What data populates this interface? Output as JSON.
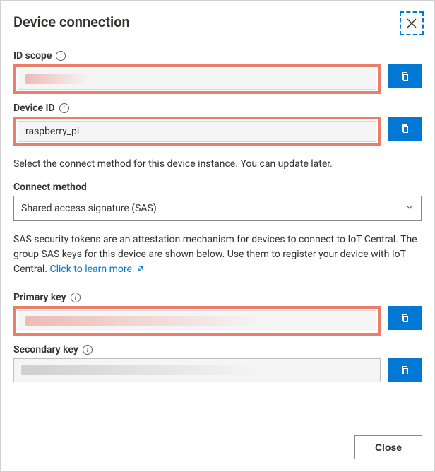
{
  "header": {
    "title": "Device connection",
    "close_label": "Close dialog"
  },
  "fields": {
    "id_scope": {
      "label": "ID scope",
      "value": ""
    },
    "device_id": {
      "label": "Device ID",
      "value": "raspberry_pi"
    },
    "primary_key": {
      "label": "Primary key",
      "value": ""
    },
    "secondary_key": {
      "label": "Secondary key",
      "value": ""
    }
  },
  "connect": {
    "instruction": "Select the connect method for this device instance. You can update later.",
    "label": "Connect method",
    "selected": "Shared access signature (SAS)"
  },
  "sas_desc": {
    "text": "SAS security tokens are an attestation mechanism for devices to connect to IoT Central. The group SAS keys for this device are shown below. Use them to register your device with IoT Central. ",
    "link_text": "Click to learn more."
  },
  "footer": {
    "close_label": "Close"
  },
  "colors": {
    "accent": "#0078d4",
    "highlight_border": "#ed7d6b"
  }
}
